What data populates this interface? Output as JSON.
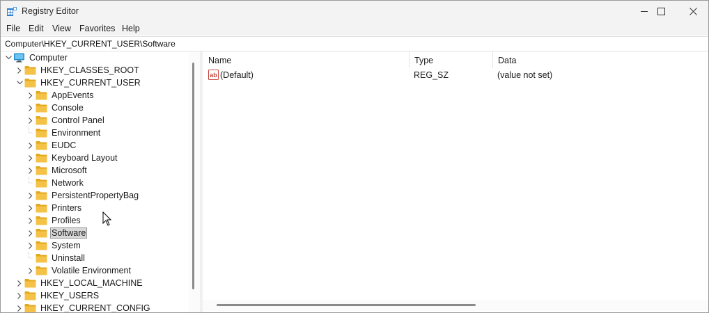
{
  "window": {
    "title": "Registry Editor"
  },
  "menu": [
    "File",
    "Edit",
    "View",
    "Favorites",
    "Help"
  ],
  "address": "Computer\\HKEY_CURRENT_USER\\Software",
  "tree": [
    {
      "label": "Computer",
      "level": 0,
      "expander": "expanded",
      "icon": "computer-icon"
    },
    {
      "label": "HKEY_CLASSES_ROOT",
      "level": 1,
      "expander": "collapsed",
      "icon": "folder-icon"
    },
    {
      "label": "HKEY_CURRENT_USER",
      "level": 1,
      "expander": "expanded",
      "icon": "folder-icon"
    },
    {
      "label": "AppEvents",
      "level": 2,
      "expander": "collapsed",
      "icon": "folder-icon"
    },
    {
      "label": "Console",
      "level": 2,
      "expander": "collapsed",
      "icon": "folder-icon"
    },
    {
      "label": "Control Panel",
      "level": 2,
      "expander": "collapsed",
      "icon": "folder-icon"
    },
    {
      "label": "Environment",
      "level": 2,
      "expander": "none",
      "icon": "folder-icon"
    },
    {
      "label": "EUDC",
      "level": 2,
      "expander": "collapsed",
      "icon": "folder-icon"
    },
    {
      "label": "Keyboard Layout",
      "level": 2,
      "expander": "collapsed",
      "icon": "folder-icon"
    },
    {
      "label": "Microsoft",
      "level": 2,
      "expander": "collapsed",
      "icon": "folder-icon"
    },
    {
      "label": "Network",
      "level": 2,
      "expander": "none",
      "icon": "folder-icon"
    },
    {
      "label": "PersistentPropertyBag",
      "level": 2,
      "expander": "collapsed",
      "icon": "folder-icon"
    },
    {
      "label": "Printers",
      "level": 2,
      "expander": "collapsed",
      "icon": "folder-icon"
    },
    {
      "label": "Profiles",
      "level": 2,
      "expander": "collapsed",
      "icon": "folder-icon"
    },
    {
      "label": "Software",
      "level": 2,
      "expander": "collapsed",
      "icon": "folder-icon",
      "selected": true
    },
    {
      "label": "System",
      "level": 2,
      "expander": "collapsed",
      "icon": "folder-icon"
    },
    {
      "label": "Uninstall",
      "level": 2,
      "expander": "none",
      "icon": "folder-icon"
    },
    {
      "label": "Volatile Environment",
      "level": 2,
      "expander": "collapsed",
      "icon": "folder-icon"
    },
    {
      "label": "HKEY_LOCAL_MACHINE",
      "level": 1,
      "expander": "collapsed",
      "icon": "folder-icon"
    },
    {
      "label": "HKEY_USERS",
      "level": 1,
      "expander": "collapsed",
      "icon": "folder-icon"
    },
    {
      "label": "HKEY_CURRENT_CONFIG",
      "level": 1,
      "expander": "collapsed",
      "icon": "folder-icon"
    }
  ],
  "columns": {
    "name": "Name",
    "type": "Type",
    "data": "Data"
  },
  "values": [
    {
      "name": "(Default)",
      "type": "REG_SZ",
      "data": "(value not set)",
      "icon": "string-value-icon"
    }
  ],
  "colors": {
    "folder": "#f4c246",
    "folder_dark": "#e3a81e",
    "computer": "#1f8fcf",
    "selection": "#d7d7d7",
    "value_icon": "#c8453b"
  }
}
